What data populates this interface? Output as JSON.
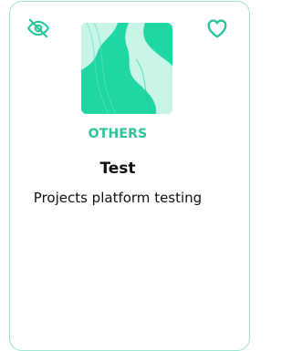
{
  "card": {
    "category": "OTHERS",
    "title": "Test",
    "description": "Projects platform testing",
    "hide_icon": "eye-off-icon",
    "favorite_icon": "heart-outline-icon",
    "thumbnail": "abstract-green-waves-thumbnail"
  },
  "colors": {
    "accent": "#2cc49a",
    "border": "#9ee6d2",
    "thumbnail_dark": "#20d6a2",
    "thumbnail_light": "#c8f5e8"
  }
}
